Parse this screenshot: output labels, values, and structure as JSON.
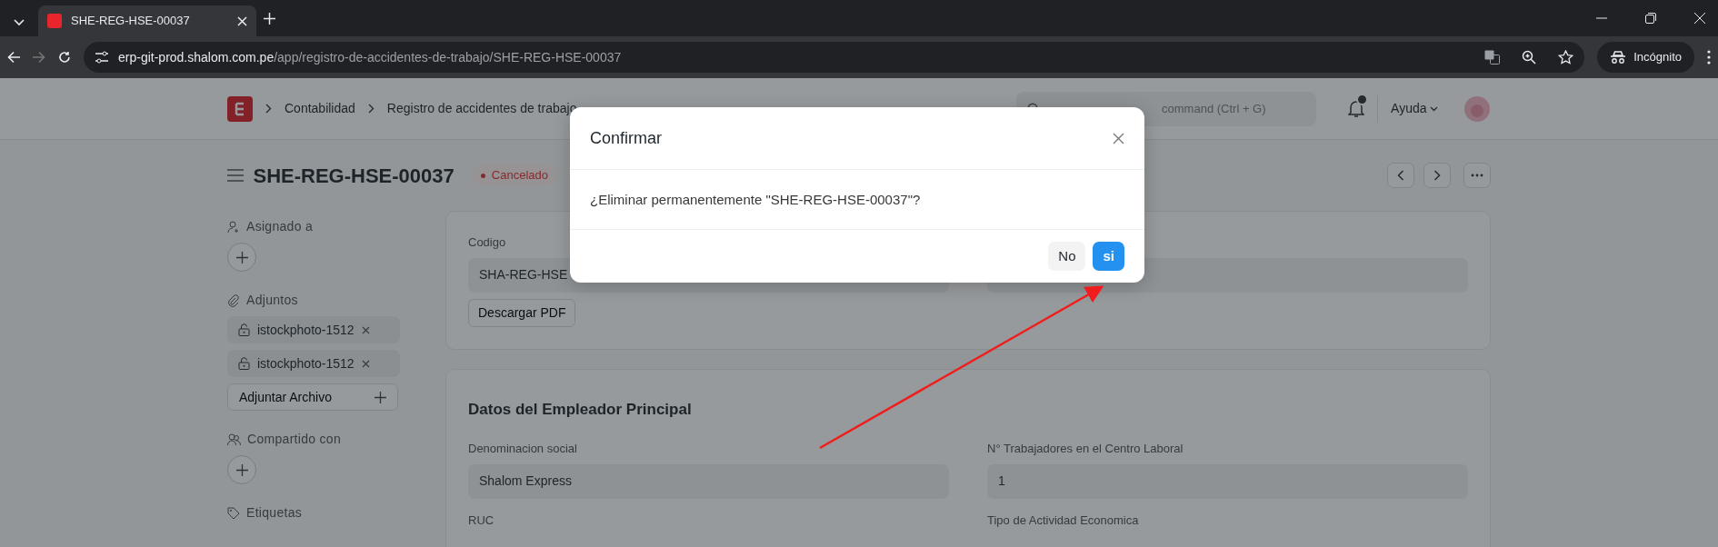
{
  "browser": {
    "tab_title": "SHE-REG-HSE-00037",
    "url_host": "erp-git-prod.shalom.com.pe",
    "url_path": "/app/registro-de-accidentes-de-trabajo/SHE-REG-HSE-00037",
    "incognito_label": "Incógnito"
  },
  "navbar": {
    "breadcrumbs": [
      "Contabilidad",
      "Registro de accidentes de trabajo"
    ],
    "search": {
      "placeholder": "command (Ctrl + G)"
    },
    "help_label": "Ayuda"
  },
  "document": {
    "title": "SHE-REG-HSE-00037",
    "status": "Cancelado"
  },
  "sidebar": {
    "assigned_label": "Asignado a",
    "attachments_label": "Adjuntos",
    "attachments": [
      "istockphoto-1512",
      "istockphoto-1512"
    ],
    "attach_button": "Adjuntar Archivo",
    "shared_label": "Compartido con",
    "tags_label": "Etiquetas"
  },
  "sections": [
    {
      "fields": [
        {
          "label": "Codigo",
          "value": "SHA-REG-HSE"
        }
      ],
      "button": "Descargar PDF"
    },
    {
      "title": "Datos del Empleador Principal",
      "fields": [
        {
          "label": "Denominacion social",
          "value": "Shalom Express"
        },
        {
          "label": "N° Trabajadores en el Centro Laboral",
          "value": "1"
        },
        {
          "label": "RUC"
        },
        {
          "label": "Tipo de Actividad Economica"
        }
      ]
    }
  ],
  "dialog": {
    "title": "Confirmar",
    "message": "¿Eliminar permanentemente \"SHE-REG-HSE-00037\"?",
    "buttons": [
      {
        "label": "No",
        "kind": "secondary"
      },
      {
        "label": "si",
        "kind": "primary"
      }
    ]
  }
}
